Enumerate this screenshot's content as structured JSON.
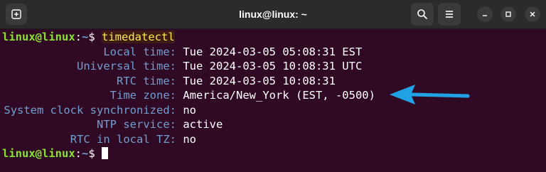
{
  "window": {
    "title": "linux@linux: ~"
  },
  "terminal": {
    "prompt": {
      "user_host": "linux@linux",
      "colon": ":",
      "path": "~",
      "symbol": "$ "
    },
    "command": "timedatectl",
    "output": [
      {
        "key": "Local time:",
        "value": "Tue 2024-03-05 05:08:31 EST"
      },
      {
        "key": "Universal time:",
        "value": "Tue 2024-03-05 10:08:31 UTC"
      },
      {
        "key": "RTC time:",
        "value": "Tue 2024-03-05 10:08:31"
      },
      {
        "key": "Time zone:",
        "value": "America/New_York (EST, -0500)"
      },
      {
        "key": "System clock synchronized:",
        "value": "no"
      },
      {
        "key": "NTP service:",
        "value": "active"
      },
      {
        "key": "RTC in local TZ:",
        "value": "no"
      }
    ]
  },
  "annotation": {
    "arrow_color": "#1fa3e6"
  },
  "icons": {
    "new_tab": "new-tab-icon",
    "search": "search-icon",
    "menu": "hamburger-menu-icon",
    "minimize": "minimize-icon",
    "maximize": "maximize-icon",
    "close": "close-icon"
  },
  "colors": {
    "terminal_bg": "#300a24",
    "prompt_user": "#8ae234",
    "prompt_path": "#729fcf",
    "key_text": "#729fcf",
    "command_text": "#fce94f"
  }
}
